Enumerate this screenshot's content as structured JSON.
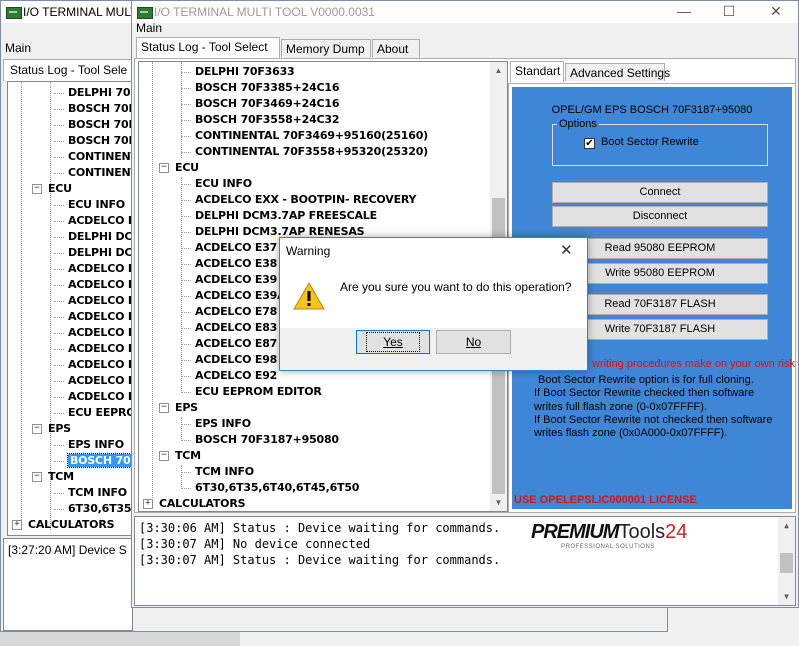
{
  "back_window": {
    "title": "I/O TERMINAL MULTI",
    "menu": "Main",
    "tab": "Status Log - Tool Sele",
    "tree": [
      "DELPHI 70F",
      "BOSCH 70F3",
      "BOSCH 70F3",
      "BOSCH 70F3",
      "CONTINENTA",
      "CONTINENTA",
      "ECU",
      "ECU INFO",
      "ACDELCO EX",
      "DELPHI DCN",
      "DELPHI DCN",
      "ACDELCO E3",
      "ACDELCO E3",
      "ACDELCO E3",
      "ACDELCO E3",
      "ACDELCO E7",
      "ACDELCO E8",
      "ACDELCO E8",
      "ACDELCO E9",
      "ACDELCO E9",
      "ECU EEPRON",
      "EPS",
      "EPS INFO",
      "BOSCH 70F3",
      "TCM",
      "TCM INFO",
      "6T30,6T35,6",
      "CALCULATORS"
    ],
    "log_line": "[3:27:20 AM] Device S"
  },
  "front_window": {
    "title": "I/O TERMINAL MULTI TOOL V0000.0031",
    "menu": "Main",
    "tabs": [
      "Status Log - Tool Select",
      "Memory Dump",
      "About"
    ],
    "tree_top": [
      "DELPHI 70F3633",
      "BOSCH 70F3385+24C16",
      "BOSCH 70F3469+24C16",
      "BOSCH 70F3558+24C32",
      "CONTINENTAL 70F3469+95160(25160)",
      "CONTINENTAL 70F3558+95320(25320)"
    ],
    "ecu_group": "ECU",
    "ecu_items": [
      "ECU INFO",
      "ACDELCO EXX - BOOTPIN- RECOVERY",
      "DELPHI DCM3.7AP FREESCALE",
      "DELPHI DCM3.7AP RENESAS",
      "ACDELCO E37",
      "ACDELCO E38",
      "ACDELCO E39",
      "ACDELCO E39A",
      "ACDELCO E78",
      "ACDELCO E83",
      "ACDELCO E87",
      "ACDELCO E98",
      "ACDELCO E92",
      "ECU EEPROM EDITOR"
    ],
    "eps_group": "EPS",
    "eps_items": [
      "EPS INFO",
      "BOSCH 70F3187+95080"
    ],
    "tcm_group": "TCM",
    "tcm_items": [
      "TCM INFO",
      "6T30,6T35,6T40,6T45,6T50"
    ],
    "calc_group": "CALCULATORS",
    "settings_tabs": [
      "Standart",
      "Advanced Settings"
    ],
    "module_title": "OPEL/GM EPS BOSCH 70F3187+95080",
    "options_label": "Options",
    "boot_sector_label": "Boot Sector Rewrite",
    "boot_sector_checked": true,
    "buttons": {
      "connect": "Connect",
      "disconnect": "Disconnect",
      "read_eeprom": "Read 95080 EEPROM",
      "write_eeprom": "Write 95080 EEPROM",
      "read_flash": "Read 70F3187 FLASH",
      "write_flash": "Write 70F3187 FLASH"
    },
    "risk_warning": "writing procedures make on your own risk",
    "info_lines": [
      "Boot Sector Rewrite option is for full cloning.",
      "If Boot Sector Rewrite checked then software",
      "writes full flash zone (0-0x07FFFF).",
      "If Boot Sector Rewrite not checked then software",
      "writes flash zone (0x0A000-0x07FFFF)."
    ],
    "license": "USE OPELEPSLIC000001 LICENSE",
    "log_lines": [
      "[3:30:06 AM] Status : Device waiting for commands.",
      "[3:30:07 AM] No device connected",
      "[3:30:07 AM] Status : Device waiting for commands."
    ],
    "logo_main": "PREMIUM",
    "logo_tools": "Tools",
    "logo_num": "24",
    "logo_sub": "PROFESSIONAL SOLUTIONS",
    "blue_panel_color": "#3f87d6"
  },
  "dialog": {
    "title": "Warning",
    "message": "Are you sure you want to do this operation?",
    "yes": "Yes",
    "no": "No",
    "icon": "warning-icon"
  }
}
